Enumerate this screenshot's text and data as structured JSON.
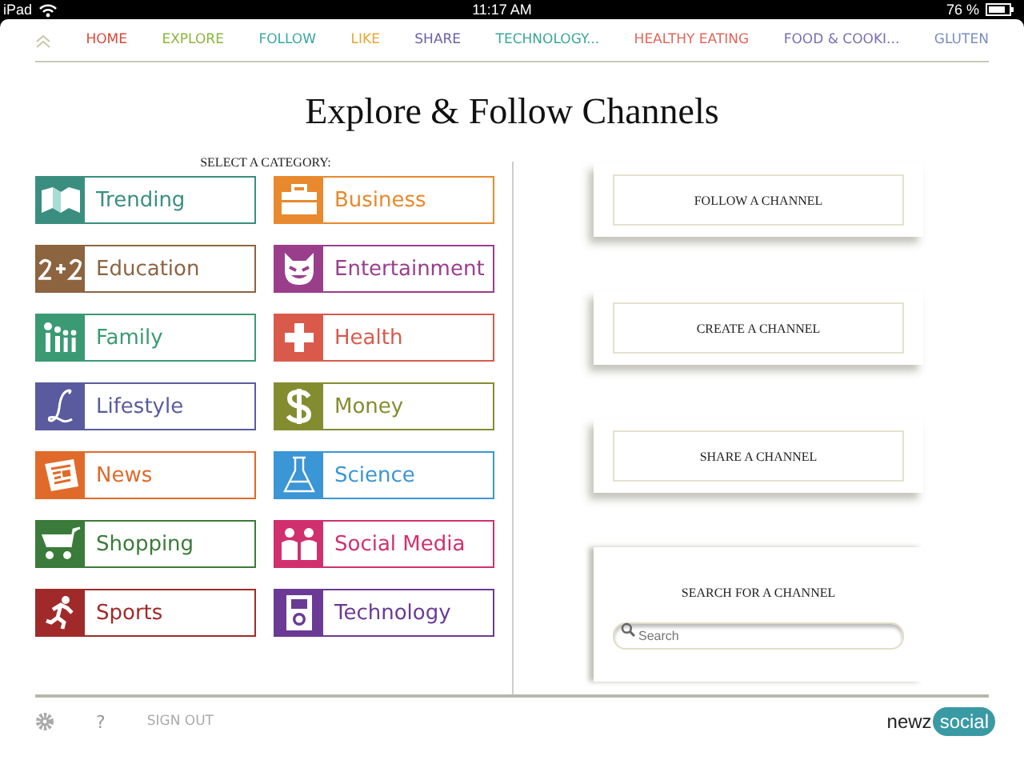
{
  "status_bar": {
    "device": "iPad",
    "time": "11:17 AM",
    "battery": "76 %"
  },
  "nav": [
    {
      "label": "HOME",
      "color": "#d9483b"
    },
    {
      "label": "EXPLORE",
      "color": "#8cb43c"
    },
    {
      "label": "FOLLOW",
      "color": "#3aa6a6"
    },
    {
      "label": "LIKE",
      "color": "#e8a630"
    },
    {
      "label": "SHARE",
      "color": "#6a5fa8"
    },
    {
      "label": "TECHNOLOGY...",
      "color": "#3aa69a"
    },
    {
      "label": "HEALTHY EATING",
      "color": "#e0675a"
    },
    {
      "label": "FOOD & COOKI...",
      "color": "#7a6cb0"
    },
    {
      "label": "GLUTEN",
      "color": "#7a8cc0"
    }
  ],
  "title": "Explore & Follow Channels",
  "category_heading": "SELECT A CATEGORY:",
  "categories": [
    {
      "label": "Trending",
      "kind": "map",
      "color": "#3a8e80"
    },
    {
      "label": "Business",
      "kind": "briefcase",
      "color": "#e8892e"
    },
    {
      "label": "Education",
      "kind": "sum",
      "color": "#8c6440"
    },
    {
      "label": "Entertainment",
      "kind": "mask",
      "color": "#9a3e8c"
    },
    {
      "label": "Family",
      "kind": "family",
      "color": "#3a9a74"
    },
    {
      "label": "Health",
      "kind": "cross",
      "color": "#d95a4a"
    },
    {
      "label": "Lifestyle",
      "kind": "script",
      "color": "#5a5a9e"
    },
    {
      "label": "Money",
      "kind": "dollar",
      "color": "#848c30"
    },
    {
      "label": "News",
      "kind": "newspaper",
      "color": "#e06a2a"
    },
    {
      "label": "Science",
      "kind": "flask",
      "color": "#3a96d4"
    },
    {
      "label": "Shopping",
      "kind": "cart",
      "color": "#3a7a3a"
    },
    {
      "label": "Social Media",
      "kind": "people",
      "color": "#d0306e"
    },
    {
      "label": "Sports",
      "kind": "runner",
      "color": "#a02a2a"
    },
    {
      "label": "Technology",
      "kind": "player",
      "color": "#6a3a94"
    }
  ],
  "actions": [
    "FOLLOW A CHANNEL",
    "CREATE A CHANNEL",
    "SHARE A CHANNEL"
  ],
  "search": {
    "heading": "SEARCH FOR A CHANNEL",
    "placeholder": "Search"
  },
  "footer": {
    "help": "?",
    "sign_out": "SIGN OUT",
    "logo_left": "newz",
    "logo_right": "social"
  }
}
